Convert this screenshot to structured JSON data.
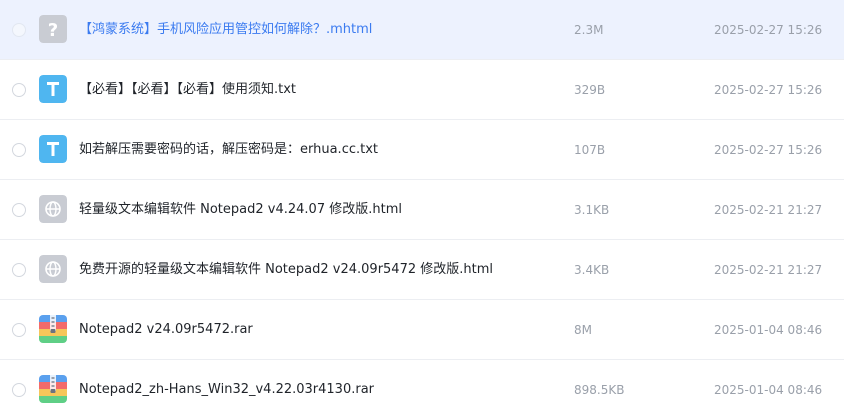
{
  "files": [
    {
      "name": "【鸿蒙系统】手机风险应用管控如何解除？.mhtml",
      "size": "2.3M",
      "date": "2025-02-27 15:26",
      "icon": "unknown-file-icon"
    },
    {
      "name": "【必看】【必看】【必看】使用须知.txt",
      "size": "329B",
      "date": "2025-02-27 15:26",
      "icon": "text-file-icon"
    },
    {
      "name": "如若解压需要密码的话，解压密码是：erhua.cc.txt",
      "size": "107B",
      "date": "2025-02-27 15:26",
      "icon": "text-file-icon"
    },
    {
      "name": "轻量级文本编辑软件 Notepad2 v4.24.07 修改版.html",
      "size": "3.1KB",
      "date": "2025-02-21 21:27",
      "icon": "web-file-icon"
    },
    {
      "name": "免费开源的轻量级文本编辑软件 Notepad2 v24.09r5472 修改版.html",
      "size": "3.4KB",
      "date": "2025-02-21 21:27",
      "icon": "web-file-icon"
    },
    {
      "name": "Notepad2 v24.09r5472.rar",
      "size": "8M",
      "date": "2025-01-04 08:46",
      "icon": "archive-file-icon"
    },
    {
      "name": "Notepad2_zh-Hans_Win32_v4.22.03r4130.rar",
      "size": "898.5KB",
      "date": "2025-01-04 08:46",
      "icon": "archive-file-icon"
    }
  ],
  "colors": {
    "selected_row_bg": "#edf2fe",
    "selected_text": "#3b7bf0",
    "text_icon": "#4fb6f0",
    "gray_icon": "#c9ccd3"
  }
}
